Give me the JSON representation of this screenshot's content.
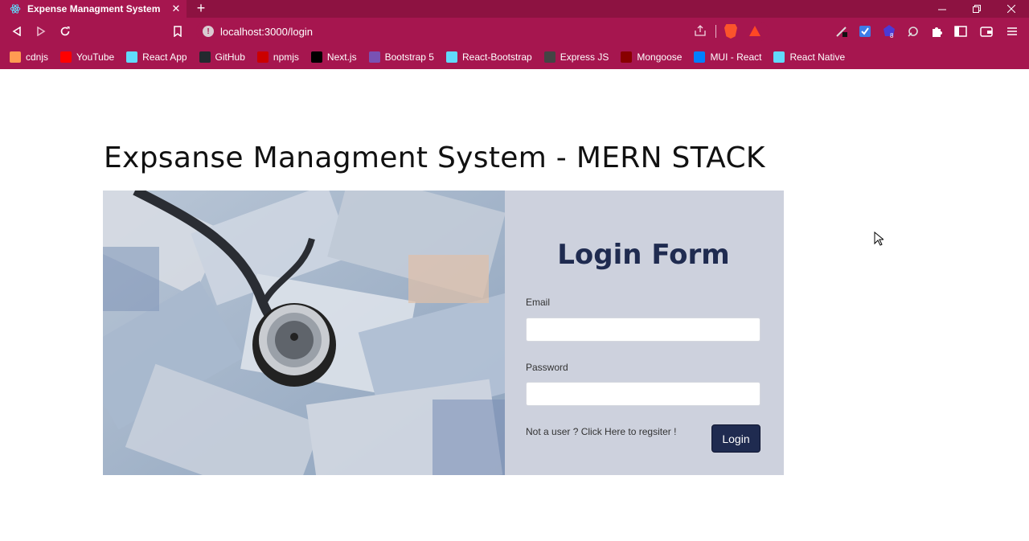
{
  "browser": {
    "tab_title": "Expense Managment System",
    "tab_close": "✕",
    "new_tab": "+",
    "url": "localhost:3000/login",
    "extension_badge": "8",
    "bookmarks": [
      {
        "label": "cdnjs",
        "icon": "code-icon",
        "color": "#ff9b52"
      },
      {
        "label": "YouTube",
        "icon": "youtube-icon",
        "color": "#ff0000"
      },
      {
        "label": "React App",
        "icon": "react-icon",
        "color": "#61dafb"
      },
      {
        "label": "GitHub",
        "icon": "github-icon",
        "color": "#24292f"
      },
      {
        "label": "npmjs",
        "icon": "npm-icon",
        "color": "#cb0000"
      },
      {
        "label": "Next.js",
        "icon": "nextjs-icon",
        "color": "#000000"
      },
      {
        "label": "Bootstrap 5",
        "icon": "bootstrap-icon",
        "color": "#7952b3"
      },
      {
        "label": "React-Bootstrap",
        "icon": "react-icon",
        "color": "#61dafb"
      },
      {
        "label": "Express JS",
        "icon": "express-icon",
        "color": "#444444"
      },
      {
        "label": "Mongoose",
        "icon": "mongoose-icon",
        "color": "#880000"
      },
      {
        "label": "MUI - React",
        "icon": "mui-icon",
        "color": "#007fff"
      },
      {
        "label": "React Native",
        "icon": "react-icon",
        "color": "#61dafb"
      }
    ]
  },
  "page": {
    "title": "Expsanse Managment System - MERN STACK",
    "form": {
      "heading": "Login Form",
      "email_label": "Email",
      "email_value": "",
      "password_label": "Password",
      "password_value": "",
      "register_text": "Not a user ? Click Here to regsiter !",
      "login_button": "Login"
    }
  },
  "colors": {
    "chrome": "#a6164f",
    "form_panel": "#cdd1dd",
    "heading": "#1f2b50",
    "button": "#1f2b50"
  }
}
